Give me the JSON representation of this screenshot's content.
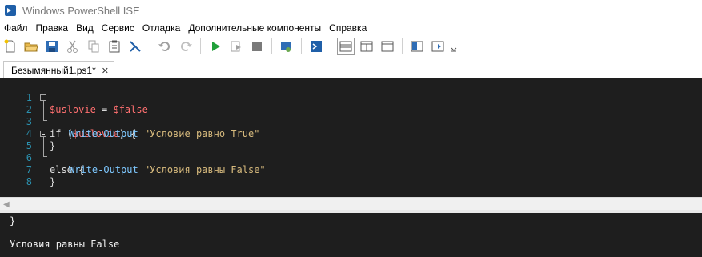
{
  "window": {
    "title": "Windows PowerShell ISE"
  },
  "menu": [
    "Файл",
    "Правка",
    "Вид",
    "Сервис",
    "Отладка",
    "Дополнительные компоненты",
    "Справка"
  ],
  "tab": {
    "label": "Безымянный1.ps1*",
    "close": "✕"
  },
  "editor": {
    "line_numbers": [
      "1",
      "2",
      "3",
      "4",
      "5",
      "6",
      "7",
      "8"
    ],
    "lines": {
      "l1_var": "$uslovie",
      "l1_eq": " = ",
      "l1_val": "$false",
      "l2_if": "if (",
      "l2_var": "$uslovie",
      "l2_rest": ") {",
      "l3_cmd": "Write-Output",
      "l3_str": "\"Условие равно True\"",
      "l4_brace": "}",
      "l5_else": "else {",
      "l6_cmd": "Write-Output",
      "l6_str": "\"Условия равны False\"",
      "l7_brace": "}"
    }
  },
  "console": {
    "line1": "}",
    "line2": "Условия равны False"
  }
}
